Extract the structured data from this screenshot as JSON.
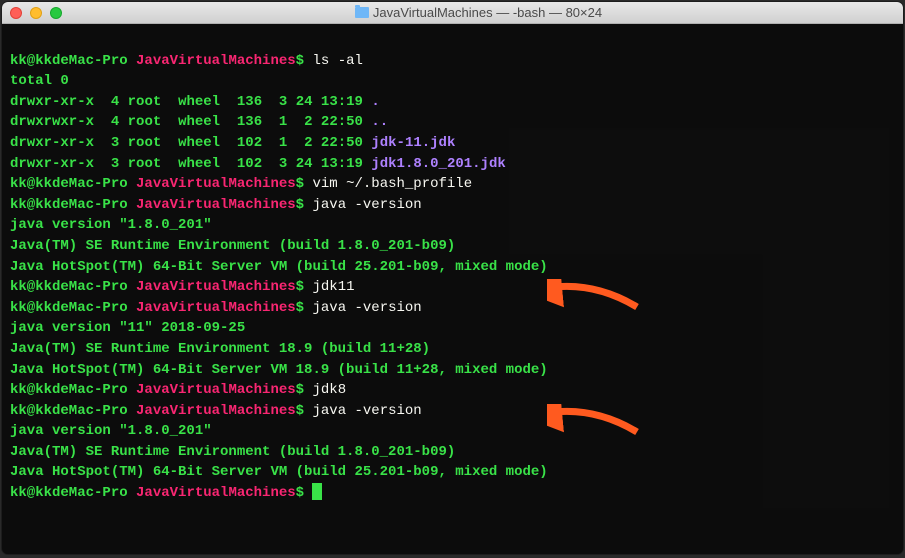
{
  "titlebar": {
    "title": "JavaVirtualMachines — -bash — 80×24"
  },
  "prompt": {
    "userHost": "kk@kkdeMac-Pro",
    "cwd": "JavaVirtualMachines",
    "symbol": "$"
  },
  "commands": {
    "lsal": "ls -al",
    "vim": "vim ~/.bash_profile",
    "javav": "java -version",
    "jdk11": "jdk11",
    "jdk8": "jdk8"
  },
  "ls": {
    "total": "total 0",
    "rows": [
      {
        "perm": "drwxr-xr-x",
        "links": "4",
        "owner": "root",
        "group": "wheel",
        "size": "136",
        "date": "3 24 13:19",
        "name": ".",
        "dir": true
      },
      {
        "perm": "drwxrwxr-x",
        "links": "4",
        "owner": "root",
        "group": "wheel",
        "size": "136",
        "date": "1  2 22:50",
        "name": "..",
        "dir": true
      },
      {
        "perm": "drwxr-xr-x",
        "links": "3",
        "owner": "root",
        "group": "wheel",
        "size": "102",
        "date": "1  2 22:50",
        "name": "jdk-11.jdk",
        "dir": true
      },
      {
        "perm": "drwxr-xr-x",
        "links": "3",
        "owner": "root",
        "group": "wheel",
        "size": "102",
        "date": "3 24 13:19",
        "name": "jdk1.8.0_201.jdk",
        "dir": true
      }
    ]
  },
  "java8": {
    "l1": "java version \"1.8.0_201\"",
    "l2": "Java(TM) SE Runtime Environment (build 1.8.0_201-b09)",
    "l3": "Java HotSpot(TM) 64-Bit Server VM (build 25.201-b09, mixed mode)"
  },
  "java11": {
    "l1": "java version \"11\" 2018-09-25",
    "l2": "Java(TM) SE Runtime Environment 18.9 (build 11+28)",
    "l3": "Java HotSpot(TM) 64-Bit Server VM 18.9 (build 11+28, mixed mode)"
  },
  "colors": {
    "arrow": "#ff5a1f"
  }
}
